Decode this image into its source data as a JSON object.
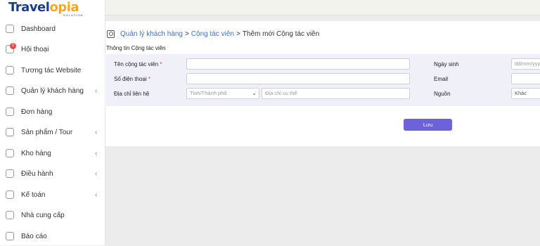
{
  "brand": {
    "part1": "Travel",
    "part2": "opia",
    "sub": "SOLUTION"
  },
  "sidebar": {
    "items": [
      {
        "label": "Dashboard",
        "icon": "dashboard-icon",
        "has_sub": false
      },
      {
        "label": "Hội thoại",
        "icon": "chat-icon",
        "has_sub": false,
        "badge": "0"
      },
      {
        "label": "Tương tác Website",
        "icon": "globe-icon",
        "has_sub": false
      },
      {
        "label": "Quản lý khách hàng",
        "icon": "users-icon",
        "has_sub": true
      },
      {
        "label": "Đơn hàng",
        "icon": "receipt-icon",
        "has_sub": false
      },
      {
        "label": "Sản phẩm / Tour",
        "icon": "flag-icon",
        "has_sub": true
      },
      {
        "label": "Kho hàng",
        "icon": "box-icon",
        "has_sub": true
      },
      {
        "label": "Điều hành",
        "icon": "folder-icon",
        "has_sub": true
      },
      {
        "label": "Kế toán",
        "icon": "calculator-icon",
        "has_sub": true
      },
      {
        "label": "Nhà cung cấp",
        "icon": "bookmark-icon",
        "has_sub": false
      },
      {
        "label": "Báo cáo",
        "icon": "report-icon",
        "has_sub": false
      }
    ],
    "chevron": "‹"
  },
  "breadcrumb": {
    "level1": "Quản lý khách hàng",
    "level2": "Cộng tác viên",
    "current": "Thêm mới Cộng tác viên",
    "separator": ">"
  },
  "section_title": "Thông tin Cộng tác viên",
  "form": {
    "name_label": "Tên cộng tác viên",
    "phone_label": "Số điện thoại",
    "address_label": "Địa chỉ liên hệ",
    "required_mark": "*",
    "name_value": "",
    "phone_value": "",
    "province_select": "Tỉnh/Thành phố",
    "address_placeholder": "Địa chỉ cụ thể",
    "birthday_label": "Ngày sinh",
    "birthday_placeholder": "dd/mm/yyyy",
    "email_label": "Email",
    "email_value": "",
    "source_label": "Nguồn",
    "source_value": "Khác"
  },
  "save_label": "Lưu",
  "colors": {
    "accent": "#6e63d6",
    "link": "#3a73c7",
    "form_bg": "#eff0f8",
    "badge": "#e74c3c"
  }
}
